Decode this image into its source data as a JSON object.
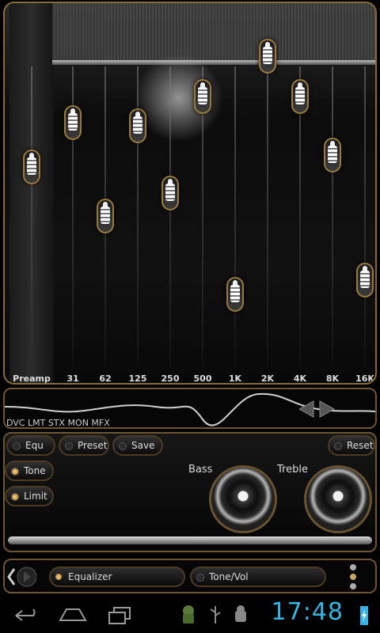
{
  "equalizer": {
    "bands": [
      {
        "label": "Preamp",
        "level": 0.58
      },
      {
        "label": "31",
        "level": 0.73
      },
      {
        "label": "62",
        "level": 0.41
      },
      {
        "label": "125",
        "level": 0.72
      },
      {
        "label": "250",
        "level": 0.49
      },
      {
        "label": "500",
        "level": 0.82
      },
      {
        "label": "1K",
        "level": 0.14
      },
      {
        "label": "2K",
        "level": 0.96
      },
      {
        "label": "4K",
        "level": 0.82
      },
      {
        "label": "8K",
        "level": 0.62
      },
      {
        "label": "16K",
        "level": 0.19
      }
    ]
  },
  "wave": {
    "status_text": "DVC LMT STX MON MFX"
  },
  "controls": {
    "equ_label": "Equ",
    "preset_label": "Preset",
    "save_label": "Save",
    "reset_label": "Reset",
    "tone_label": "Tone",
    "limit_label": "Limit",
    "bass_label": "Bass",
    "treble_label": "Treble"
  },
  "tabs": {
    "equalizer_label": "Equalizer",
    "tone_vol_label": "Tone/Vol"
  },
  "system": {
    "clock": "17:48"
  },
  "colors": {
    "accent": "#8a6a35",
    "clock": "#33b5e5"
  }
}
